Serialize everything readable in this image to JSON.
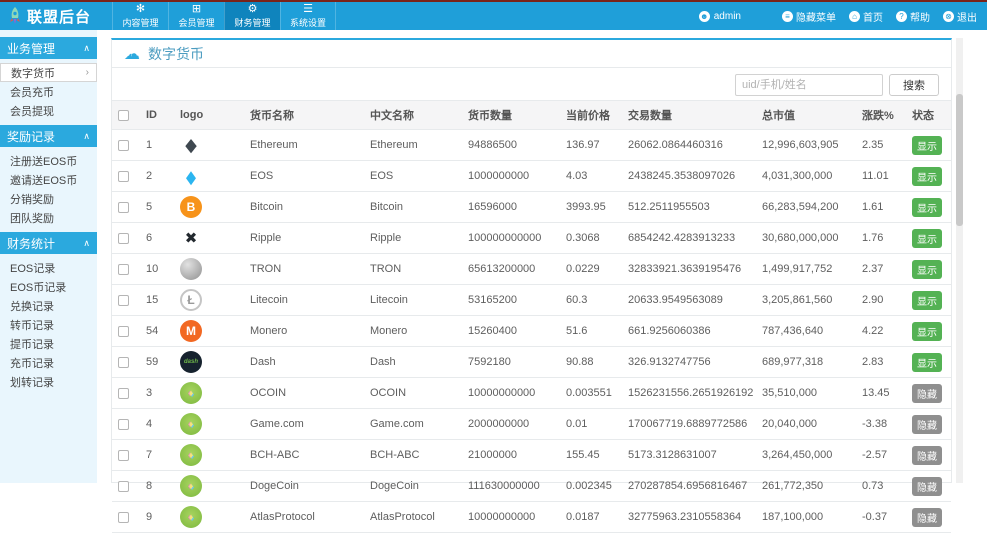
{
  "app": {
    "title": "联盟后台"
  },
  "colors": {
    "header_blue": "#1f9fd9",
    "section_blue": "#2ba9de",
    "badge_show_green": "#54b254",
    "badge_hide_gray": "#8f8f8f",
    "top_line_maroon": "#7a231a"
  },
  "header": {
    "nav": [
      {
        "icon_name": "snowflake-icon",
        "icon": "✻",
        "label": "内容管理",
        "state": ""
      },
      {
        "icon_name": "grid-icon",
        "icon": "⊞",
        "label": "会员管理",
        "state": ""
      },
      {
        "icon_name": "wrench-icon",
        "icon": "⚙",
        "label": "财务管理",
        "state": "active"
      },
      {
        "icon_name": "list-icon",
        "icon": "☰",
        "label": "系统设置",
        "state": ""
      }
    ],
    "admin": {
      "icon_name": "user-icon",
      "icon": "☻",
      "label": "admin"
    },
    "links": [
      {
        "icon_name": "hide-menu-icon",
        "icon": "≡",
        "label": "隐藏菜单"
      },
      {
        "icon_name": "home-icon",
        "icon": "⌂",
        "label": "首页"
      },
      {
        "icon_name": "help-icon",
        "icon": "?",
        "label": "帮助"
      },
      {
        "icon_name": "logout-icon",
        "icon": "⊗",
        "label": "退出"
      }
    ]
  },
  "sidebar": {
    "sections": [
      {
        "title": "业务管理",
        "collapse_icon": "∧",
        "items": [
          {
            "label": "数字货币",
            "state": "active",
            "arrow": "›"
          },
          {
            "label": "会员充币",
            "state": "",
            "arrow": ""
          },
          {
            "label": "会员提现",
            "state": "",
            "arrow": ""
          }
        ]
      },
      {
        "title": "奖励记录",
        "collapse_icon": "∧",
        "items": [
          {
            "label": "注册送EOS币",
            "state": "",
            "arrow": ""
          },
          {
            "label": "邀请送EOS币",
            "state": "",
            "arrow": ""
          },
          {
            "label": "分销奖励",
            "state": "",
            "arrow": ""
          },
          {
            "label": "团队奖励",
            "state": "",
            "arrow": ""
          }
        ]
      },
      {
        "title": "财务统计",
        "collapse_icon": "∧",
        "items": [
          {
            "label": "EOS记录",
            "state": "",
            "arrow": ""
          },
          {
            "label": "EOS币记录",
            "state": "",
            "arrow": ""
          },
          {
            "label": "兑换记录",
            "state": "",
            "arrow": ""
          },
          {
            "label": "转币记录",
            "state": "",
            "arrow": ""
          },
          {
            "label": "提币记录",
            "state": "",
            "arrow": ""
          },
          {
            "label": "充币记录",
            "state": "",
            "arrow": ""
          },
          {
            "label": "划转记录",
            "state": "",
            "arrow": ""
          }
        ]
      }
    ]
  },
  "main": {
    "title": "数字货币",
    "title_icon": "cloud-upload-icon",
    "search": {
      "placeholder": "uid/手机/姓名",
      "button": "搜索"
    },
    "table": {
      "columns": [
        "ID",
        "logo",
        "货币名称",
        "中文名称",
        "货币数量",
        "当前价格",
        "交易数量",
        "总市值",
        "涨跌%",
        "状态"
      ],
      "rows": [
        {
          "id": "1",
          "logo": "eth",
          "name": "Ethereum",
          "cname": "Ethereum",
          "qty": "94886500",
          "price": "136.97",
          "volume": "26062.0864460316",
          "mcap": "12,996,603,905",
          "change": "2.35",
          "status": "show",
          "status_label": "显示"
        },
        {
          "id": "2",
          "logo": "eos",
          "name": "EOS",
          "cname": "EOS",
          "qty": "1000000000",
          "price": "4.03",
          "volume": "2438245.3538097026",
          "mcap": "4,031,300,000",
          "change": "11.01",
          "status": "show",
          "status_label": "显示"
        },
        {
          "id": "5",
          "logo": "btc",
          "name": "Bitcoin",
          "cname": "Bitcoin",
          "qty": "16596000",
          "price": "3993.95",
          "volume": "512.2511955503",
          "mcap": "66,283,594,200",
          "change": "1.61",
          "status": "show",
          "status_label": "显示"
        },
        {
          "id": "6",
          "logo": "xrp",
          "name": "Ripple",
          "cname": "Ripple",
          "qty": "100000000000",
          "price": "0.3068",
          "volume": "6854242.4283913233",
          "mcap": "30,680,000,000",
          "change": "1.76",
          "status": "show",
          "status_label": "显示"
        },
        {
          "id": "10",
          "logo": "trx",
          "name": "TRON",
          "cname": "TRON",
          "qty": "65613200000",
          "price": "0.0229",
          "volume": "32833921.3639195476",
          "mcap": "1,499,917,752",
          "change": "2.37",
          "status": "show",
          "status_label": "显示"
        },
        {
          "id": "15",
          "logo": "ltc",
          "name": "Litecoin",
          "cname": "Litecoin",
          "qty": "53165200",
          "price": "60.3",
          "volume": "20633.9549563089",
          "mcap": "3,205,861,560",
          "change": "2.90",
          "status": "show",
          "status_label": "显示"
        },
        {
          "id": "54",
          "logo": "xmr",
          "name": "Monero",
          "cname": "Monero",
          "qty": "15260400",
          "price": "51.6",
          "volume": "661.9256060386",
          "mcap": "787,436,640",
          "change": "4.22",
          "status": "show",
          "status_label": "显示"
        },
        {
          "id": "59",
          "logo": "dash",
          "name": "Dash",
          "cname": "Dash",
          "qty": "7592180",
          "price": "90.88",
          "volume": "326.9132747756",
          "mcap": "689,977,318",
          "change": "2.83",
          "status": "show",
          "status_label": "显示"
        },
        {
          "id": "3",
          "logo": "default",
          "name": "OCOIN",
          "cname": "OCOIN",
          "qty": "10000000000",
          "price": "0.003551",
          "volume": "1526231556.2651926192",
          "mcap": "35,510,000",
          "change": "13.45",
          "status": "hide",
          "status_label": "隐藏"
        },
        {
          "id": "4",
          "logo": "default",
          "name": "Game.com",
          "cname": "Game.com",
          "qty": "2000000000",
          "price": "0.01",
          "volume": "170067719.6889772586",
          "mcap": "20,040,000",
          "change": "-3.38",
          "status": "hide",
          "status_label": "隐藏"
        },
        {
          "id": "7",
          "logo": "default",
          "name": "BCH-ABC",
          "cname": "BCH-ABC",
          "qty": "21000000",
          "price": "155.45",
          "volume": "5173.3128631007",
          "mcap": "3,264,450,000",
          "change": "-2.57",
          "status": "hide",
          "status_label": "隐藏"
        },
        {
          "id": "8",
          "logo": "default",
          "name": "DogeCoin",
          "cname": "DogeCoin",
          "qty": "111630000000",
          "price": "0.002345",
          "volume": "270287854.6956816467",
          "mcap": "261,772,350",
          "change": "0.73",
          "status": "hide",
          "status_label": "隐藏"
        },
        {
          "id": "9",
          "logo": "default",
          "name": "AtlasProtocol",
          "cname": "AtlasProtocol",
          "qty": "10000000000",
          "price": "0.0187",
          "volume": "32775963.2310558364",
          "mcap": "187,100,000",
          "change": "-0.37",
          "status": "hide",
          "status_label": "隐藏"
        }
      ]
    }
  }
}
